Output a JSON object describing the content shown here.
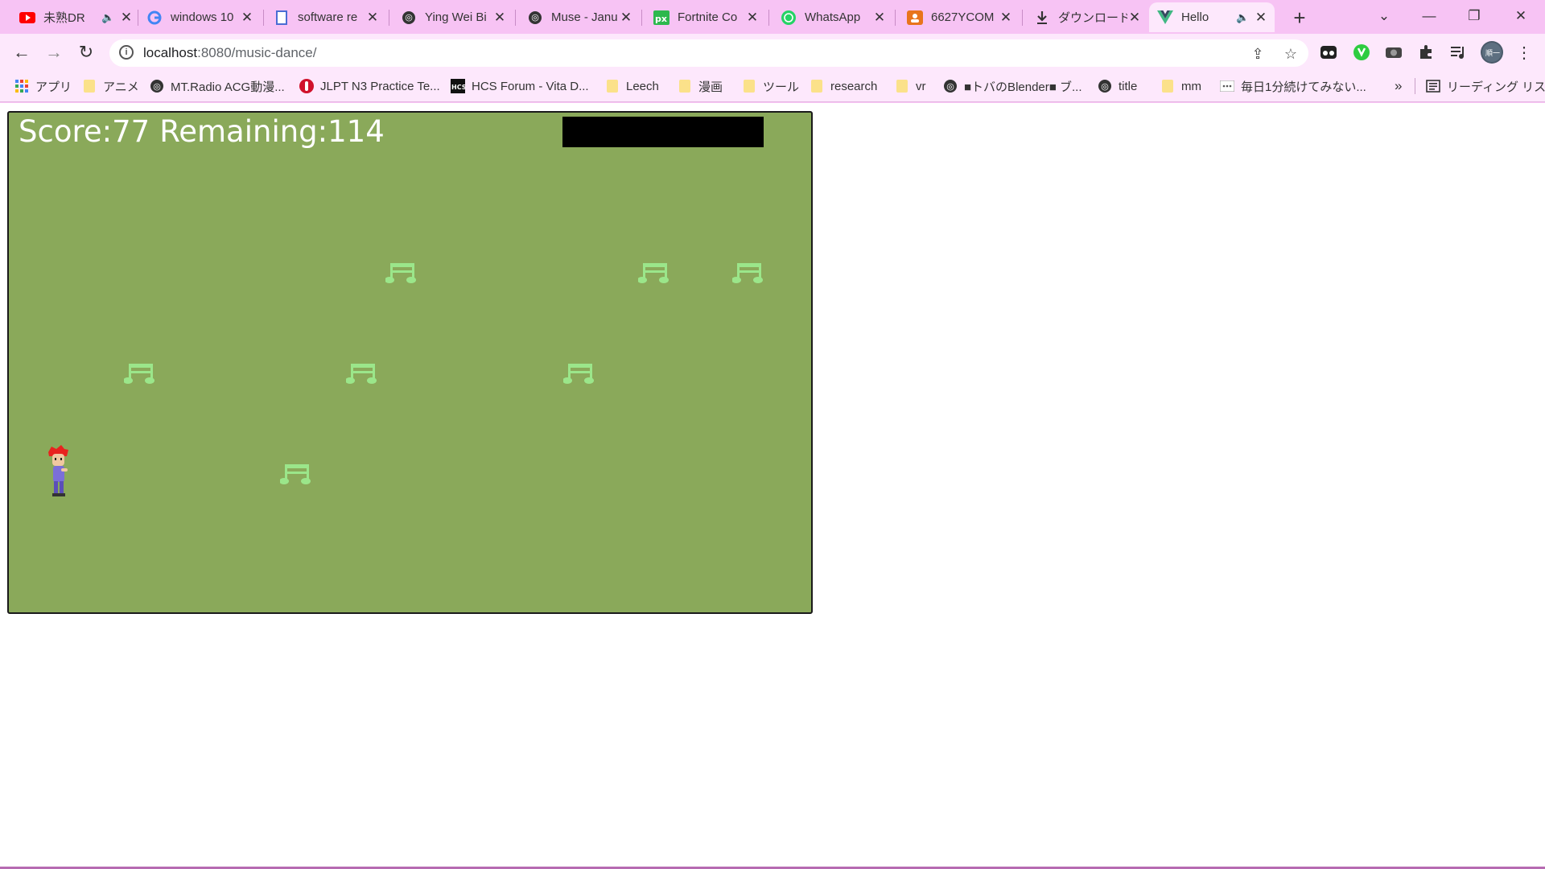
{
  "tabs": [
    {
      "title": "未熟DR",
      "icon": "youtube-icon",
      "audio": true
    },
    {
      "title": "windows 10",
      "icon": "google-icon",
      "audio": false
    },
    {
      "title": "software re",
      "icon": "doc-icon",
      "audio": false
    },
    {
      "title": "Ying Wei Bi",
      "icon": "globe-icon",
      "audio": false
    },
    {
      "title": "Muse - Janu",
      "icon": "globe-icon",
      "audio": false
    },
    {
      "title": "Fortnite Co",
      "icon": "px-icon",
      "audio": false
    },
    {
      "title": "WhatsApp",
      "icon": "whatsapp-icon",
      "audio": false
    },
    {
      "title": "6627YCOM",
      "icon": "contact-icon",
      "audio": false
    },
    {
      "title": "ダウンロード",
      "icon": "download-icon",
      "audio": false
    },
    {
      "title": "Hello",
      "icon": "vue-icon",
      "audio": true,
      "active": true
    }
  ],
  "address": {
    "host": "localhost",
    "path": ":8080/music-dance/"
  },
  "bookmarks": [
    {
      "label": "アプリ",
      "icon": "apps-icon"
    },
    {
      "label": "アニメ",
      "icon": "folder-icon"
    },
    {
      "label": "MT.Radio ACG動漫...",
      "icon": "globe-icon"
    },
    {
      "label": "JLPT N3 Practice Te...",
      "icon": "jlpt-icon"
    },
    {
      "label": "HCS Forum - Vita D...",
      "icon": "hcs-icon"
    },
    {
      "label": "Leech",
      "icon": "folder-icon"
    },
    {
      "label": "漫画",
      "icon": "folder-icon"
    },
    {
      "label": "ツール",
      "icon": "folder-icon"
    },
    {
      "label": "research",
      "icon": "folder-icon"
    },
    {
      "label": "vr",
      "icon": "folder-icon"
    },
    {
      "label": "■トバのBlender■ ブ...",
      "icon": "globe-icon"
    },
    {
      "label": "title",
      "icon": "globe-icon"
    },
    {
      "label": "mm",
      "icon": "folder-icon"
    },
    {
      "label": "毎日1分続けてみない...",
      "icon": "dots-icon"
    }
  ],
  "bookmark_more": "»",
  "reading_list": "リーディング リスト",
  "game": {
    "score_label": "Score:77",
    "remaining_label": "Remaining:114",
    "colors": {
      "background": "#8aa95a",
      "note": "#9be68a",
      "hud": "#ffffff"
    }
  }
}
